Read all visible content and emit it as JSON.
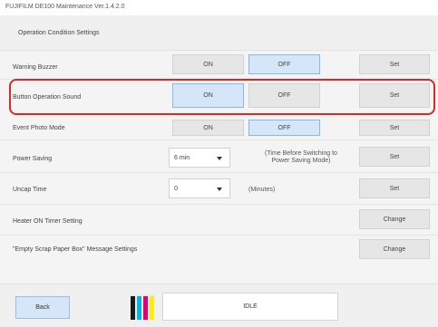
{
  "window": {
    "title": "FUJIFILM DE100 Maintenance Ver.1.4.2.0"
  },
  "header": {
    "title": "Operation Condition Settings"
  },
  "rows": {
    "warning_buzzer": {
      "label": "Warning Buzzer",
      "on": "ON",
      "off": "OFF",
      "selected": "OFF",
      "set": "Set"
    },
    "button_sound": {
      "label": "Button Operation Sound",
      "on": "ON",
      "off": "OFF",
      "selected": "ON",
      "set": "Set"
    },
    "event_photo": {
      "label": "Event Photo Mode",
      "on": "ON",
      "off": "OFF",
      "selected": "OFF",
      "set": "Set"
    },
    "power_saving": {
      "label": "Power Saving",
      "value": "6 min",
      "note_line1": "(Time Before Switching to",
      "note_line2": "Power Saving Mode)",
      "set": "Set"
    },
    "uncap_time": {
      "label": "Uncap Time",
      "value": "0",
      "note": "(Minutes)",
      "set": "Set"
    },
    "heater_timer": {
      "label": "Heater ON Timer Setting",
      "change": "Change"
    },
    "scrap_paper": {
      "label": "\"Empty Scrap Paper Box\" Message Settings",
      "change": "Change"
    }
  },
  "footer": {
    "back_label": "Back",
    "status_label": "IDLE",
    "ink_colors": [
      "#1a1a1a",
      "#00b6ea",
      "#e2007a",
      "#ffee00"
    ]
  },
  "colors": {
    "highlight": "#d92a2a",
    "selected": "#d4e6f8"
  }
}
